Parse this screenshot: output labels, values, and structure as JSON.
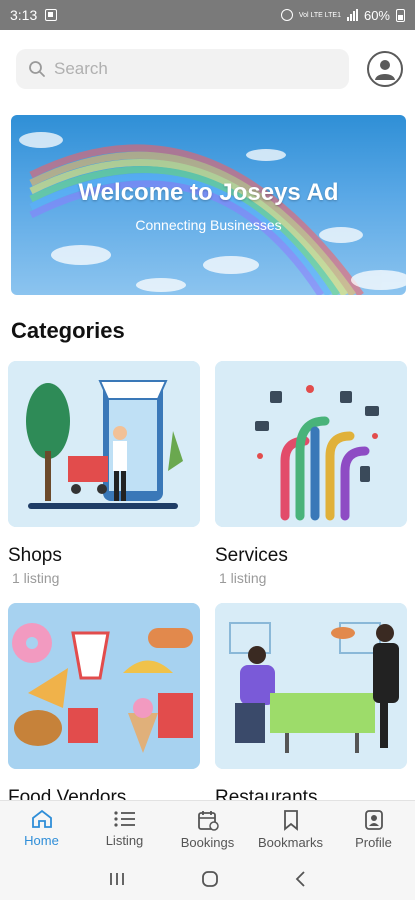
{
  "status_bar": {
    "time": "3:13",
    "network_label": "Vol LTE LTE1",
    "battery": "60%"
  },
  "search": {
    "placeholder": "Search"
  },
  "banner": {
    "title": "Welcome to Joseys Ad",
    "subtitle": "Connecting Businesses"
  },
  "categories_title": "Categories",
  "categories": [
    {
      "name": "Shops",
      "count": "1 listing"
    },
    {
      "name": "Services",
      "count": "1 listing"
    },
    {
      "name": "Food Vendors",
      "count": ""
    },
    {
      "name": "Restaurants",
      "count": ""
    }
  ],
  "bottom_nav": [
    {
      "label": "Home",
      "icon": "home-icon",
      "active": true
    },
    {
      "label": "Listing",
      "icon": "list-icon",
      "active": false
    },
    {
      "label": "Bookings",
      "icon": "calendar-icon",
      "active": false
    },
    {
      "label": "Bookmarks",
      "icon": "bookmark-icon",
      "active": false
    },
    {
      "label": "Profile",
      "icon": "profile-icon",
      "active": false
    }
  ],
  "colors": {
    "accent": "#2f8ed8",
    "card_bg": "#d5ebf7",
    "status_bar": "#7a7a7a"
  }
}
